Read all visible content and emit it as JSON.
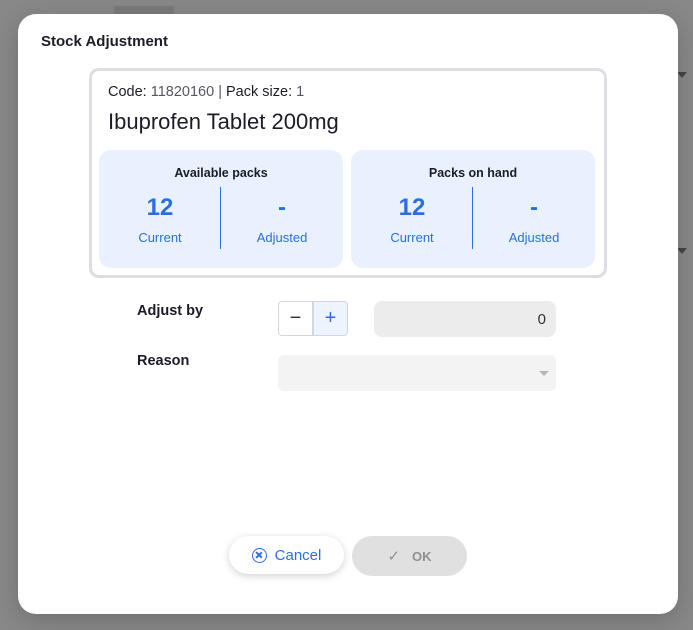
{
  "dialog": {
    "title": "Stock Adjustment"
  },
  "item": {
    "code_label": "Code:",
    "code_value": "11820160",
    "separator": "|",
    "pack_size_label": "Pack size:",
    "pack_size_value": "1",
    "name": "Ibuprofen Tablet 200mg"
  },
  "stats": {
    "available": {
      "title": "Available packs",
      "current_value": "12",
      "current_label": "Current",
      "adjusted_value": "-",
      "adjusted_label": "Adjusted"
    },
    "on_hand": {
      "title": "Packs on hand",
      "current_value": "12",
      "current_label": "Current",
      "adjusted_value": "-",
      "adjusted_label": "Adjusted"
    }
  },
  "form": {
    "adjust_label": "Adjust by",
    "decrement_symbol": "−",
    "increment_symbol": "+",
    "adjust_value": "0",
    "reason_label": "Reason",
    "reason_value": ""
  },
  "actions": {
    "cancel_label": "Cancel",
    "ok_label": "OK",
    "ok_icon": "✓"
  },
  "colors": {
    "accent": "#2a6fe0",
    "panel": "#e8f1fd",
    "disabled": "#e0e0e0"
  }
}
